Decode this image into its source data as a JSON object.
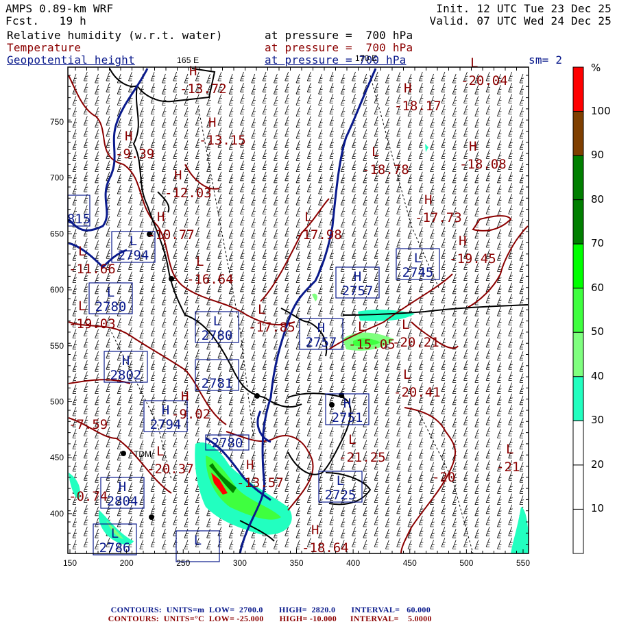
{
  "header": {
    "model": "AMPS 0.89-km WRF",
    "forecast": "Fcst.   19 h",
    "init": "Init. 12 UTC Tue 23 Dec 25",
    "valid": "Valid. 07 UTC Wed 24 Dec 25",
    "fields": [
      {
        "name": "Relative humidity (w.r.t. water)",
        "level": "at pressure =  700 hPa"
      },
      {
        "name": "Temperature",
        "level": "at pressure =  700 hPa"
      },
      {
        "name": "Geopotential height",
        "level": "at pressure = 700 hPa"
      }
    ],
    "smoothing": "sm= 2",
    "lon_labels": [
      "165 E",
      "170 E"
    ]
  },
  "colorbar": {
    "unit": "%",
    "labels": [
      "100",
      "90",
      "80",
      "70",
      "60",
      "50",
      "40",
      "30",
      "20",
      "10"
    ],
    "colors": [
      "#ff0000",
      "#7f3f00",
      "#007f00",
      "#007f00",
      "#00ff00",
      "#3fff3f",
      "#7fff7f",
      "#22ffc0",
      "#ffffff",
      "#ffffff",
      "#ffffff"
    ]
  },
  "axes": {
    "x_ticks": [
      "150",
      "200",
      "250",
      "300",
      "350",
      "400",
      "450",
      "500",
      "550"
    ],
    "y_ticks": [
      "400",
      "450",
      "500",
      "550",
      "600",
      "650",
      "700",
      "750"
    ]
  },
  "map": {
    "temperature_extrema": [
      {
        "type": "H",
        "value": "-13.72"
      },
      {
        "type": "H",
        "value": "-13.15"
      },
      {
        "type": "H",
        "value": "-9.39"
      },
      {
        "type": "H",
        "value": "-12.03"
      },
      {
        "type": "H",
        "value": "-10.77"
      },
      {
        "type": "L",
        "value": "-16.64"
      },
      {
        "type": "L",
        "value": "-11.66"
      },
      {
        "type": "L",
        "value": "-19.03"
      },
      {
        "type": "H",
        "value": "-18.17"
      },
      {
        "type": "L",
        "value": "-20.04"
      },
      {
        "type": "L",
        "value": "-18.78"
      },
      {
        "type": "H",
        "value": "-18.08"
      },
      {
        "type": "H",
        "value": "-17.73"
      },
      {
        "type": "L",
        "value": "-17.98"
      },
      {
        "type": "H",
        "value": "-19.45"
      },
      {
        "type": "L",
        "value": "-17.85"
      },
      {
        "type": "L",
        "value": "-20.21"
      },
      {
        "type": "L",
        "value": "-20.41"
      },
      {
        "type": "L",
        "value": "-21.25"
      },
      {
        "type": "L",
        "value": "-21"
      },
      {
        "type": "H",
        "value": "-18.64"
      },
      {
        "type": "L",
        "value": "-20.37"
      },
      {
        "type": "H",
        "value": "-13.57"
      },
      {
        "type": "H",
        "value": "-9.02"
      },
      {
        "type": "L",
        "value": "-15.05"
      },
      {
        "type": "",
        "value": "-20"
      },
      {
        "type": "",
        "value": "-7.59"
      },
      {
        "type": "",
        "value": "-0.74"
      }
    ],
    "height_extrema": [
      {
        "type": "",
        "value": "815"
      },
      {
        "type": "L",
        "value": "2794"
      },
      {
        "type": "L",
        "value": "2780"
      },
      {
        "type": "H",
        "value": "2757"
      },
      {
        "type": "L",
        "value": "2745"
      },
      {
        "type": "L",
        "value": "2780"
      },
      {
        "type": "H",
        "value": "2802"
      },
      {
        "type": "",
        "value": "2781"
      },
      {
        "type": "H",
        "value": "2794"
      },
      {
        "type": "",
        "value": "2780"
      },
      {
        "type": "H",
        "value": "2804"
      },
      {
        "type": "L",
        "value": "2786"
      },
      {
        "type": "L",
        "value": ""
      },
      {
        "type": "H",
        "value": "2757"
      },
      {
        "type": "H",
        "value": "2751"
      },
      {
        "type": "L",
        "value": "2725"
      }
    ],
    "station_label": "TDM"
  },
  "footer": {
    "height_contours": {
      "label": "CONTOURS:",
      "units": "UNITS=m",
      "low": "LOW=  2700.0",
      "high": "HIGH=  2820.0",
      "interval": "INTERVAL=   60.000"
    },
    "temp_contours": {
      "label": "CONTOURS:",
      "units": "UNITS=°C",
      "low": "LOW= -25.000",
      "high": "HIGH= -10.000",
      "interval": "INTERVAL=    5.0000"
    }
  }
}
